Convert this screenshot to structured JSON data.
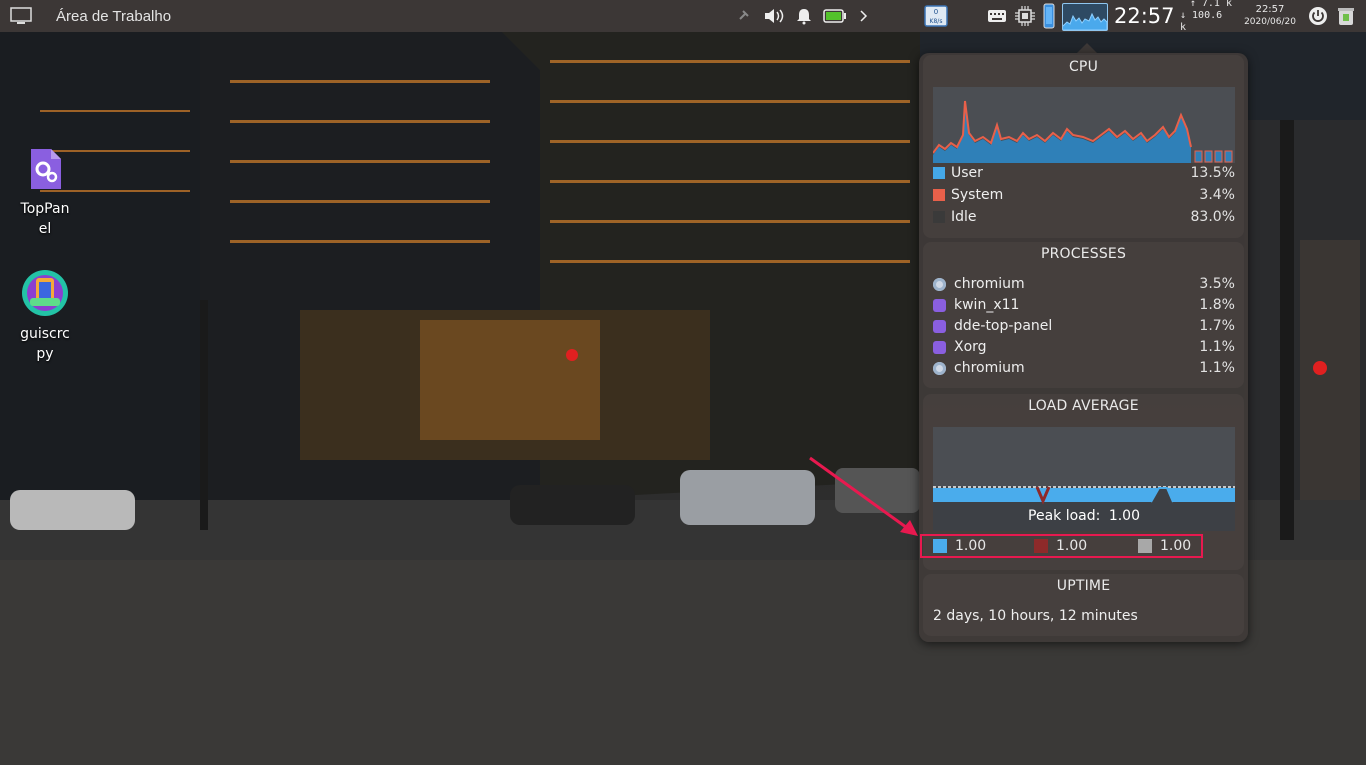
{
  "top_panel": {
    "title": "Área de Trabalho",
    "clock": "22:57",
    "net_up": "↑  7.1 k",
    "net_down": "↓ 100.6 k",
    "date_time": "22:57",
    "date": "2020/06/20",
    "kbs_label": "K8/s",
    "kbs_value": "0",
    "icons": [
      "desktop-icon",
      "pin-icon",
      "volume-icon",
      "bell-icon",
      "battery-icon",
      "chevron-right-icon",
      "network-speed-icon",
      "keyboard-icon",
      "cpu-chip-icon",
      "phone-icon",
      "cpu-graph-icon",
      "power-icon",
      "trash-icon"
    ]
  },
  "desktop": {
    "icons": [
      {
        "label": "TopPan\nel",
        "icon": "gear-icon"
      },
      {
        "label": "guiscrc\npy",
        "icon": "android-icon"
      }
    ]
  },
  "popup": {
    "cpu": {
      "title": "CPU",
      "stats": [
        {
          "label": "User",
          "value": "13.5%",
          "color": "#45a8e8"
        },
        {
          "label": "System",
          "value": "3.4%",
          "color": "#e8604a"
        },
        {
          "label": "Idle",
          "value": "83.0%",
          "color": "#3a3a3a"
        }
      ]
    },
    "processes": {
      "title": "PROCESSES",
      "items": [
        {
          "name": "chromium",
          "value": "3.5%",
          "icon": "chromium-icon"
        },
        {
          "name": "kwin_x11",
          "value": "1.8%",
          "icon": "app-icon"
        },
        {
          "name": "dde-top-panel",
          "value": "1.7%",
          "icon": "app-icon"
        },
        {
          "name": "Xorg",
          "value": "1.1%",
          "icon": "app-icon"
        },
        {
          "name": "chromium",
          "value": "1.1%",
          "icon": "chromium-icon"
        }
      ]
    },
    "load_average": {
      "title": "LOAD AVERAGE",
      "peak_label": "Peak load:",
      "peak_value": "1.00",
      "values": [
        {
          "value": "1.00",
          "color": "#4aacec"
        },
        {
          "value": "1.00",
          "color": "#8e2a2a"
        },
        {
          "value": "1.00",
          "color": "#a8a8a8"
        }
      ]
    },
    "uptime": {
      "title": "UPTIME",
      "text": "2 days, 10 hours, 12 minutes"
    }
  },
  "colors": {
    "accent": "#45a8e8",
    "highlight": "#e8194f",
    "panel": "#3c3736"
  }
}
